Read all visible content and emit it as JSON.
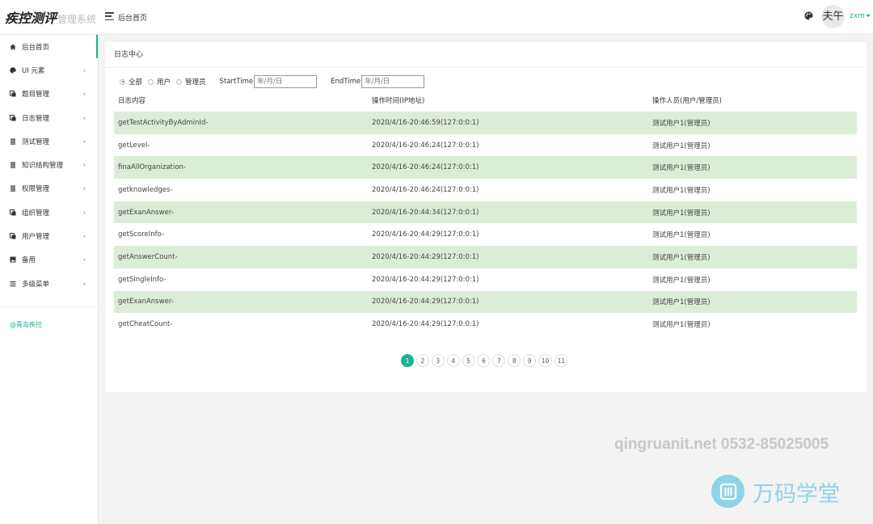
{
  "header": {
    "brand_title": "疾控测评",
    "brand_subtitle": "管理系统",
    "page_title": "后台首页",
    "avatar_text": "夫午",
    "username": "zxm"
  },
  "sidebar": {
    "items": [
      {
        "label": "后台首页",
        "icon": "home-icon",
        "has_arrow": false
      },
      {
        "label": "UI 元素",
        "icon": "palette-icon",
        "has_arrow": true
      },
      {
        "label": "题目管理",
        "icon": "copy-icon",
        "has_arrow": true
      },
      {
        "label": "日志管理",
        "icon": "copy-icon",
        "has_arrow": true
      },
      {
        "label": "测试管理",
        "icon": "list-icon",
        "has_arrow": true
      },
      {
        "label": "知识结构管理",
        "icon": "list-icon",
        "has_arrow": true
      },
      {
        "label": "权限管理",
        "icon": "list-icon",
        "has_arrow": true
      },
      {
        "label": "组织管理",
        "icon": "copy-icon",
        "has_arrow": true
      },
      {
        "label": "用户管理",
        "icon": "copy-icon",
        "has_arrow": true
      },
      {
        "label": "备用",
        "icon": "image-icon",
        "has_arrow": true
      },
      {
        "label": "多级菜单",
        "icon": "menu-icon",
        "has_arrow": true
      }
    ],
    "footer_text": "@青岛疾控"
  },
  "panel": {
    "title": "日志中心",
    "filters": {
      "radios": [
        "全部",
        "用户",
        "管理员"
      ],
      "start_label": "StartTime",
      "start_placeholder": "年/月/日",
      "end_label": "EndTime",
      "end_placeholder": "年/月/日"
    },
    "columns": [
      "日志内容",
      "操作时间(IP地址)",
      "操作人员(用户/管理员)"
    ],
    "rows": [
      [
        "getTestActivityByAdminId-",
        "2020/4/16-20:46:59(127:0:0:1)",
        "测试用户1(管理员)"
      ],
      [
        "getLevel-",
        "2020/4/16-20:46:24(127:0:0:1)",
        "测试用户1(管理员)"
      ],
      [
        "finaAllOrganization-",
        "2020/4/16-20:46:24(127:0:0:1)",
        "测试用户1(管理员)"
      ],
      [
        "getknowledges-",
        "2020/4/16-20:46:24(127:0:0:1)",
        "测试用户1(管理员)"
      ],
      [
        "getExanAnswer-",
        "2020/4/16-20:44:34(127:0:0:1)",
        "测试用户1(管理员)"
      ],
      [
        "getScoreInfo-",
        "2020/4/16-20:44:29(127:0:0:1)",
        "测试用户1(管理员)"
      ],
      [
        "getAnswerCount-",
        "2020/4/16-20:44:29(127:0:0:1)",
        "测试用户1(管理员)"
      ],
      [
        "getSingleInfo-",
        "2020/4/16-20:44:29(127:0:0:1)",
        "测试用户1(管理员)"
      ],
      [
        "getExanAnswer-",
        "2020/4/16-20:44:29(127:0:0:1)",
        "测试用户1(管理员)"
      ],
      [
        "getCheatCount-",
        "2020/4/16-20:44:29(127:0:0:1)",
        "测试用户1(管理员)"
      ]
    ],
    "pages": [
      "1",
      "2",
      "3",
      "4",
      "5",
      "6",
      "7",
      "8",
      "9",
      "10",
      "11"
    ],
    "current_page": "1"
  },
  "watermark": {
    "contact": "qingruanit.net 0532-85025005",
    "brand": "万码学堂"
  },
  "colors": {
    "accent": "#1ab394",
    "row_stripe": "#dcedd7",
    "watermark": "#8fd3e9"
  }
}
